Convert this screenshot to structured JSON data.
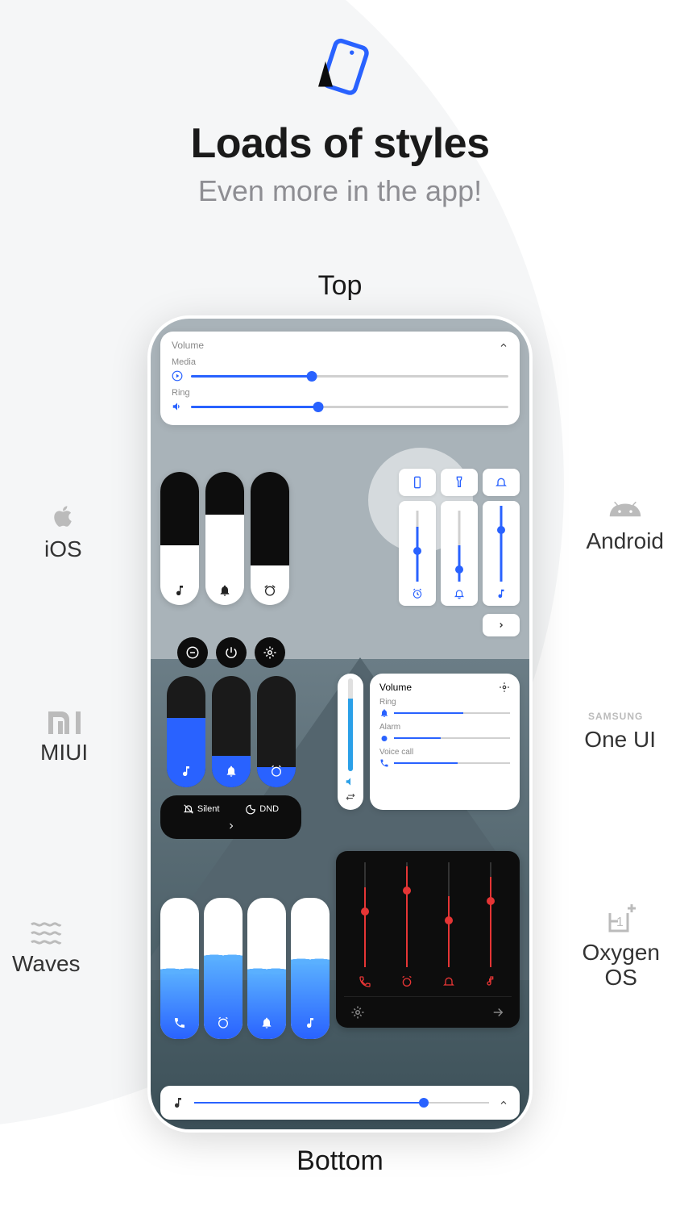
{
  "hero": {
    "title": "Loads of styles",
    "subtitle": "Even more in the app!"
  },
  "positions": {
    "top": "Top",
    "bottom": "Bottom"
  },
  "styles": {
    "ios": "iOS",
    "android": "Android",
    "miui": "MIUI",
    "oneui": "One UI",
    "waves": "Waves",
    "oxygen": "Oxygen\nOS"
  },
  "panels": {
    "top": {
      "title": "Volume",
      "media": {
        "label": "Media",
        "value": 38
      },
      "ring": {
        "label": "Ring",
        "value": 40
      }
    },
    "ios": {
      "sliders": [
        {
          "icon": "music",
          "value": 45
        },
        {
          "icon": "bell",
          "value": 68
        },
        {
          "icon": "alarm",
          "value": 30
        }
      ]
    },
    "android": {
      "buttons": [
        "phone",
        "flashlight",
        "bell"
      ],
      "sliders": [
        {
          "icon": "alarm",
          "value": 52
        },
        {
          "icon": "bell",
          "value": 35
        },
        {
          "icon": "music",
          "value": 72
        }
      ]
    },
    "miui": {
      "topButtons": [
        "dnd",
        "power",
        "settings"
      ],
      "sliders": [
        {
          "icon": "music",
          "value": 62
        },
        {
          "icon": "bell",
          "value": 28
        },
        {
          "icon": "alarm",
          "value": 18
        }
      ],
      "modes": {
        "silent": "Silent",
        "dnd": "DND"
      }
    },
    "oneui": {
      "mini": {
        "value": 78
      },
      "title": "Volume",
      "rows": [
        {
          "label": "Ring",
          "icon": "bell",
          "value": 60
        },
        {
          "label": "Alarm",
          "icon": "alarm",
          "value": 40
        },
        {
          "label": "Voice call",
          "icon": "phone",
          "value": 55
        }
      ]
    },
    "waves": {
      "sliders": [
        {
          "icon": "phone",
          "value": 48
        },
        {
          "icon": "alarm",
          "value": 58
        },
        {
          "icon": "bell",
          "value": 48
        },
        {
          "icon": "music",
          "value": 55
        }
      ]
    },
    "oxygen": {
      "sliders": [
        {
          "icon": "phone",
          "value": 62
        },
        {
          "icon": "alarm",
          "value": 78
        },
        {
          "icon": "bell",
          "value": 55
        },
        {
          "icon": "music",
          "value": 70
        }
      ]
    },
    "bottom": {
      "value": 78
    }
  }
}
